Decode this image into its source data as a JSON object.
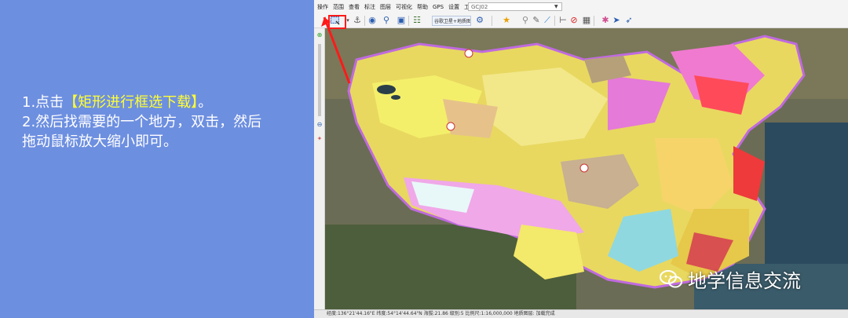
{
  "instructions": {
    "step1_prefix": "1.点击",
    "step1_highlight": "【矩形进行框选下载】",
    "step1_suffix": "。",
    "step2_line1": "2.然后找需要的一个地方，双击，然后",
    "step2_line2": "拖动鼠标放大缩小即可。"
  },
  "app": {
    "menu": [
      "操作",
      "范围",
      "查看",
      "标注",
      "图层",
      "可视化",
      "帮助",
      "GPS",
      "设置",
      "工具"
    ],
    "combo_value": "GCJ02",
    "toolbar": {
      "layer_select_label": "谷歌卫星+地质图"
    },
    "statusbar_text": "经度:136°21'44.16\"E 纬度:54°14'44.64\"N   海拔:21.86   级别:5   比例尺:1:16,000,000   地质图层: 加载完成"
  },
  "icons": {
    "rect_select": "rectangle-select-icon",
    "globe": "globe-icon",
    "zoom": "zoom-icon",
    "fullscreen": "fullscreen-icon",
    "favorite": "star-icon",
    "marker": "map-pin-icon",
    "ruler": "ruler-icon",
    "stop": "stop-icon"
  },
  "colors": {
    "panel_bg": "#6d8fe0",
    "highlight": "#ffff33",
    "red_marker": "#ff1a1a",
    "boundary": "#c06ae0"
  },
  "watermark": {
    "text": "地学信息交流"
  }
}
